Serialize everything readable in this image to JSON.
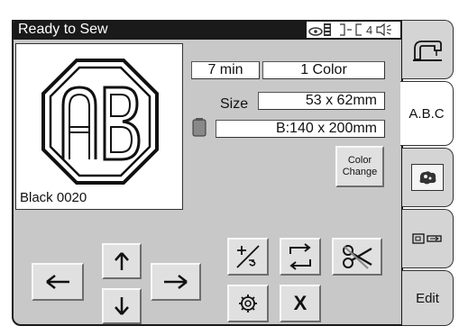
{
  "status": {
    "text": "Ready to Sew",
    "indicator": "4"
  },
  "preview": {
    "monogram": "AB",
    "thread_label": "Black  0020"
  },
  "info": {
    "time": "7 min",
    "colors": "1 Color",
    "size_label": "Size",
    "size_value": "53 x 62mm",
    "hoop": "B:140 x 200mm"
  },
  "buttons": {
    "color_change_line1": "Color",
    "color_change_line2": "Change",
    "cancel": "X"
  },
  "tabs": [
    {
      "label": "",
      "icon": "sewing-machine-icon"
    },
    {
      "label": "A.B.C",
      "icon": ""
    },
    {
      "label": "",
      "icon": "embroidery-design-icon"
    },
    {
      "label": "",
      "icon": "usb-card-icon"
    },
    {
      "label": "Edit",
      "icon": ""
    }
  ],
  "colors": {
    "status_bar": "#1a1a1a",
    "panel": "#c8c8c8",
    "button": "#e0e0e0"
  }
}
